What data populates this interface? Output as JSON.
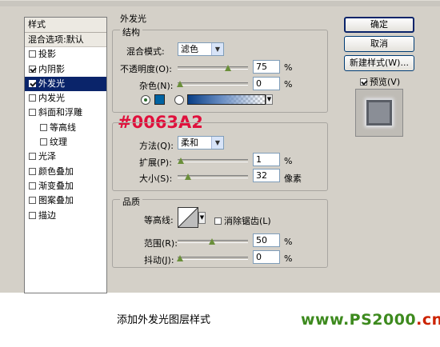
{
  "style_list": {
    "header": "样式",
    "blend_options": "混合选项:默认",
    "items": [
      {
        "label": "投影",
        "checked": false,
        "sub": false,
        "selected": false
      },
      {
        "label": "内阴影",
        "checked": true,
        "sub": false,
        "selected": false
      },
      {
        "label": "外发光",
        "checked": true,
        "sub": false,
        "selected": true
      },
      {
        "label": "内发光",
        "checked": false,
        "sub": false,
        "selected": false
      },
      {
        "label": "斜面和浮雕",
        "checked": false,
        "sub": false,
        "selected": false
      },
      {
        "label": "等高线",
        "checked": false,
        "sub": true,
        "selected": false
      },
      {
        "label": "纹理",
        "checked": false,
        "sub": true,
        "selected": false
      },
      {
        "label": "光泽",
        "checked": false,
        "sub": false,
        "selected": false
      },
      {
        "label": "颜色叠加",
        "checked": false,
        "sub": false,
        "selected": false
      },
      {
        "label": "渐变叠加",
        "checked": false,
        "sub": false,
        "selected": false
      },
      {
        "label": "图案叠加",
        "checked": false,
        "sub": false,
        "selected": false
      },
      {
        "label": "描边",
        "checked": false,
        "sub": false,
        "selected": false
      }
    ]
  },
  "panel": {
    "title": "外发光",
    "structure": {
      "title": "结构",
      "blend_mode_label": "混合模式:",
      "blend_mode_value": "滤色",
      "opacity_label": "不透明度(O):",
      "opacity_value": "75",
      "opacity_unit": "%",
      "opacity_level": 0.75,
      "noise_label": "杂色(N):",
      "noise_value": "0",
      "noise_unit": "%",
      "noise_level": 0
    },
    "color_code": "#0063A2",
    "elements": {
      "technique_label": "方法(Q):",
      "technique_value": "柔和",
      "spread_label": "扩展(P):",
      "spread_value": "1",
      "spread_unit": "%",
      "spread_level": 0.01,
      "size_label": "大小(S):",
      "size_value": "32",
      "size_unit": "像素",
      "size_level": 0.13
    },
    "quality": {
      "title": "品质",
      "contour_label": "等高线:",
      "antialias_label": "消除锯齿(L)",
      "range_label": "范围(R):",
      "range_value": "50",
      "range_unit": "%",
      "range_level": 0.5,
      "jitter_label": "抖动(J):",
      "jitter_value": "0",
      "jitter_unit": "%",
      "jitter_level": 0
    }
  },
  "buttons": {
    "ok": "确定",
    "cancel": "取消",
    "new_style": "新建样式(W)...",
    "preview_label": "预览(V)",
    "preview_checked": true
  },
  "colors": {
    "glow_color": "#0063A2",
    "selection": "#0A246A",
    "color_code_text": "#E0103C"
  },
  "caption": "添加外发光图层样式",
  "watermark": {
    "main": "www.PS2000",
    "suffix": ".cn"
  }
}
